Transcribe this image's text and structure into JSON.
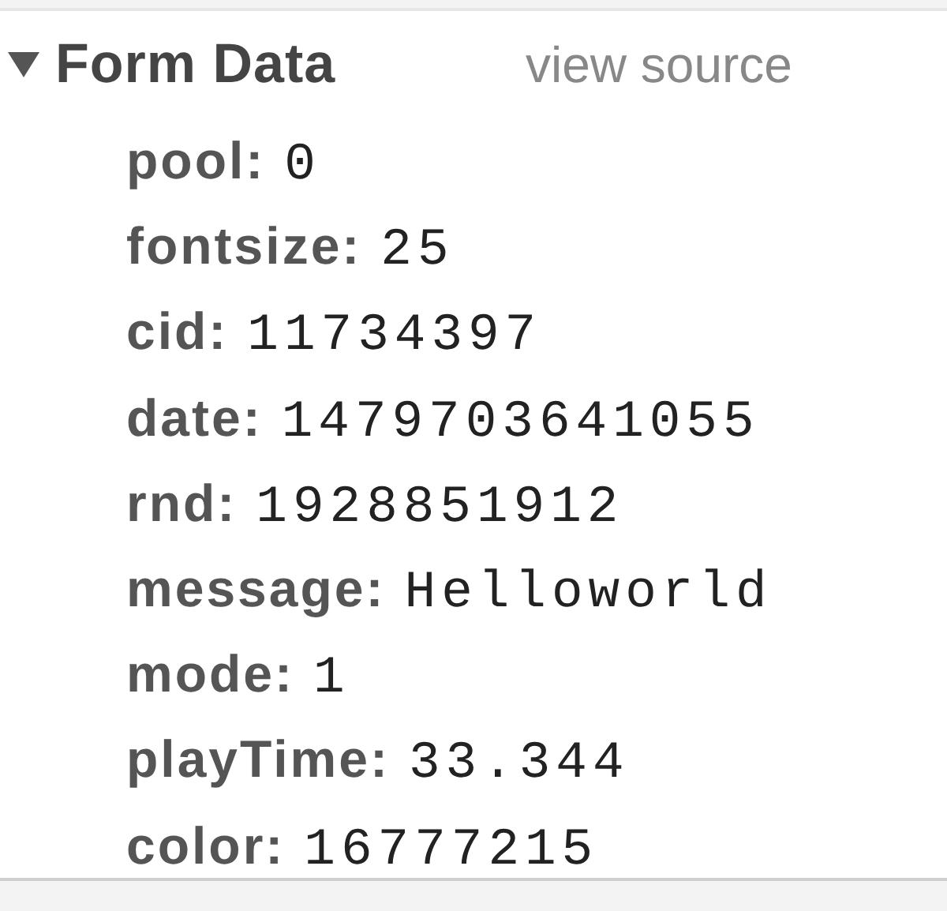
{
  "section": {
    "title": "Form Data",
    "expanded": true,
    "link": "view source",
    "fields": [
      {
        "key": "pool:",
        "value": "0"
      },
      {
        "key": "fontsize:",
        "value": "25"
      },
      {
        "key": "cid:",
        "value": "11734397"
      },
      {
        "key": "date:",
        "value": "1479703641055"
      },
      {
        "key": "rnd:",
        "value": "1928851912"
      },
      {
        "key": "message:",
        "value": "Helloworld"
      },
      {
        "key": "mode:",
        "value": "1"
      },
      {
        "key": "playTime:",
        "value": "33.344"
      },
      {
        "key": "color:",
        "value": "16777215"
      }
    ]
  }
}
